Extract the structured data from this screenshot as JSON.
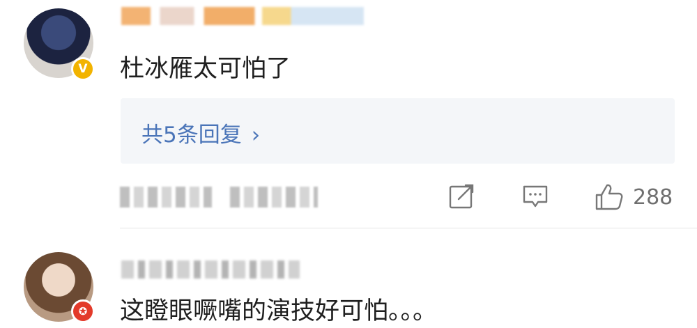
{
  "comments": [
    {
      "text": "杜冰雁太可怕了",
      "badge": "V",
      "badge_color": "#f2b300",
      "replies_label": "共5条回复",
      "replies_chevron": "›",
      "likes": "288"
    },
    {
      "text": "这瞪眼噘嘴的演技好可怕。。。",
      "badge": "✪",
      "badge_color": "#e33a2a"
    }
  ],
  "icons": {
    "share": "share-icon",
    "comment": "comment-icon",
    "like": "like-icon"
  },
  "colors": {
    "link": "#4a74b8",
    "replies_bg": "#f4f6f9",
    "text": "#1f1f1f",
    "muted": "#6f6f6f"
  }
}
